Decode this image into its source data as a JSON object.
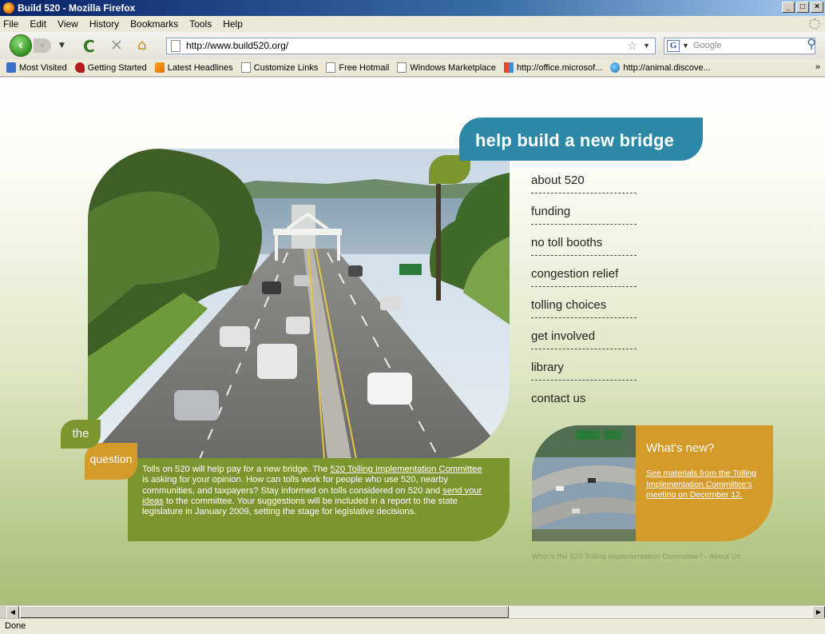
{
  "window": {
    "title": "Build 520 - Mozilla Firefox"
  },
  "menu": [
    "File",
    "Edit",
    "View",
    "History",
    "Bookmarks",
    "Tools",
    "Help"
  ],
  "toolbar": {
    "url": "http://www.build520.org/",
    "search_placeholder": "Google",
    "search_engine_letter": "G"
  },
  "bookmarks": [
    {
      "label": "Most Visited",
      "icon": "blue"
    },
    {
      "label": "Getting Started",
      "icon": "red"
    },
    {
      "label": "Latest Headlines",
      "icon": "rss"
    },
    {
      "label": "Customize Links",
      "icon": "page"
    },
    {
      "label": "Free Hotmail",
      "icon": "page"
    },
    {
      "label": "Windows Marketplace",
      "icon": "page"
    },
    {
      "label": "http://office.microsof...",
      "icon": "office"
    },
    {
      "label": "http://animal.discove...",
      "icon": "globe"
    }
  ],
  "page": {
    "banner": "help build a new bridge",
    "nav": [
      "about 520",
      "funding",
      "no toll booths",
      "congestion relief",
      "tolling choices",
      "get involved",
      "library",
      "contact us"
    ],
    "tag_the": "the",
    "tag_question": "question",
    "question": {
      "text_1": "Tolls on 520 will help pay for a new bridge. The ",
      "link_1": "520 Tolling Implementation Committee",
      "text_2": " is asking for your opinion. How can tolls work for people who use 520, nearby communities, and taxpayers? Stay informed on tolls considered on 520 and ",
      "link_2": "send your ideas",
      "text_3": " to the committee. Your suggestions will be included in a report to the state legislature in January 2009, setting the stage for legislative decisions."
    },
    "whats_new": {
      "title": "What's new?",
      "link": "See materials from the Tolling Implementation Committee's meeting on December 12."
    },
    "footer": "Who is the 520 Tolling Implementation Committee? - About Us"
  },
  "status": "Done",
  "colors": {
    "banner_blue": "#2d88a7",
    "leaf_green": "#7d952e",
    "accent_gold": "#d49a2a"
  }
}
